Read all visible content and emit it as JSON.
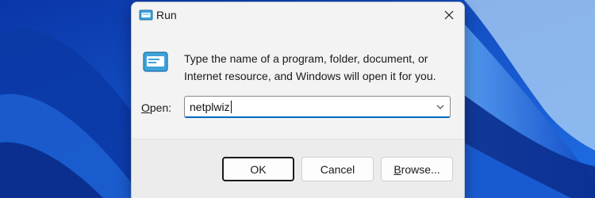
{
  "window": {
    "title": "Run",
    "title_icon": "run-icon",
    "close_icon": "close-icon"
  },
  "content": {
    "icon": "run-app-icon",
    "description": "Type the name of a program, folder, document, or Internet resource, and Windows will open it for you."
  },
  "open_field": {
    "label_prefix": "O",
    "label_rest": "pen:",
    "value": "netplwiz",
    "dropdown_icon": "chevron-down-icon"
  },
  "buttons": {
    "ok": "OK",
    "cancel": "Cancel",
    "browse_prefix": "B",
    "browse_rest": "rowse..."
  },
  "colors": {
    "accent": "#0067c0",
    "wallpaper_blue": "#0d3fb0"
  }
}
